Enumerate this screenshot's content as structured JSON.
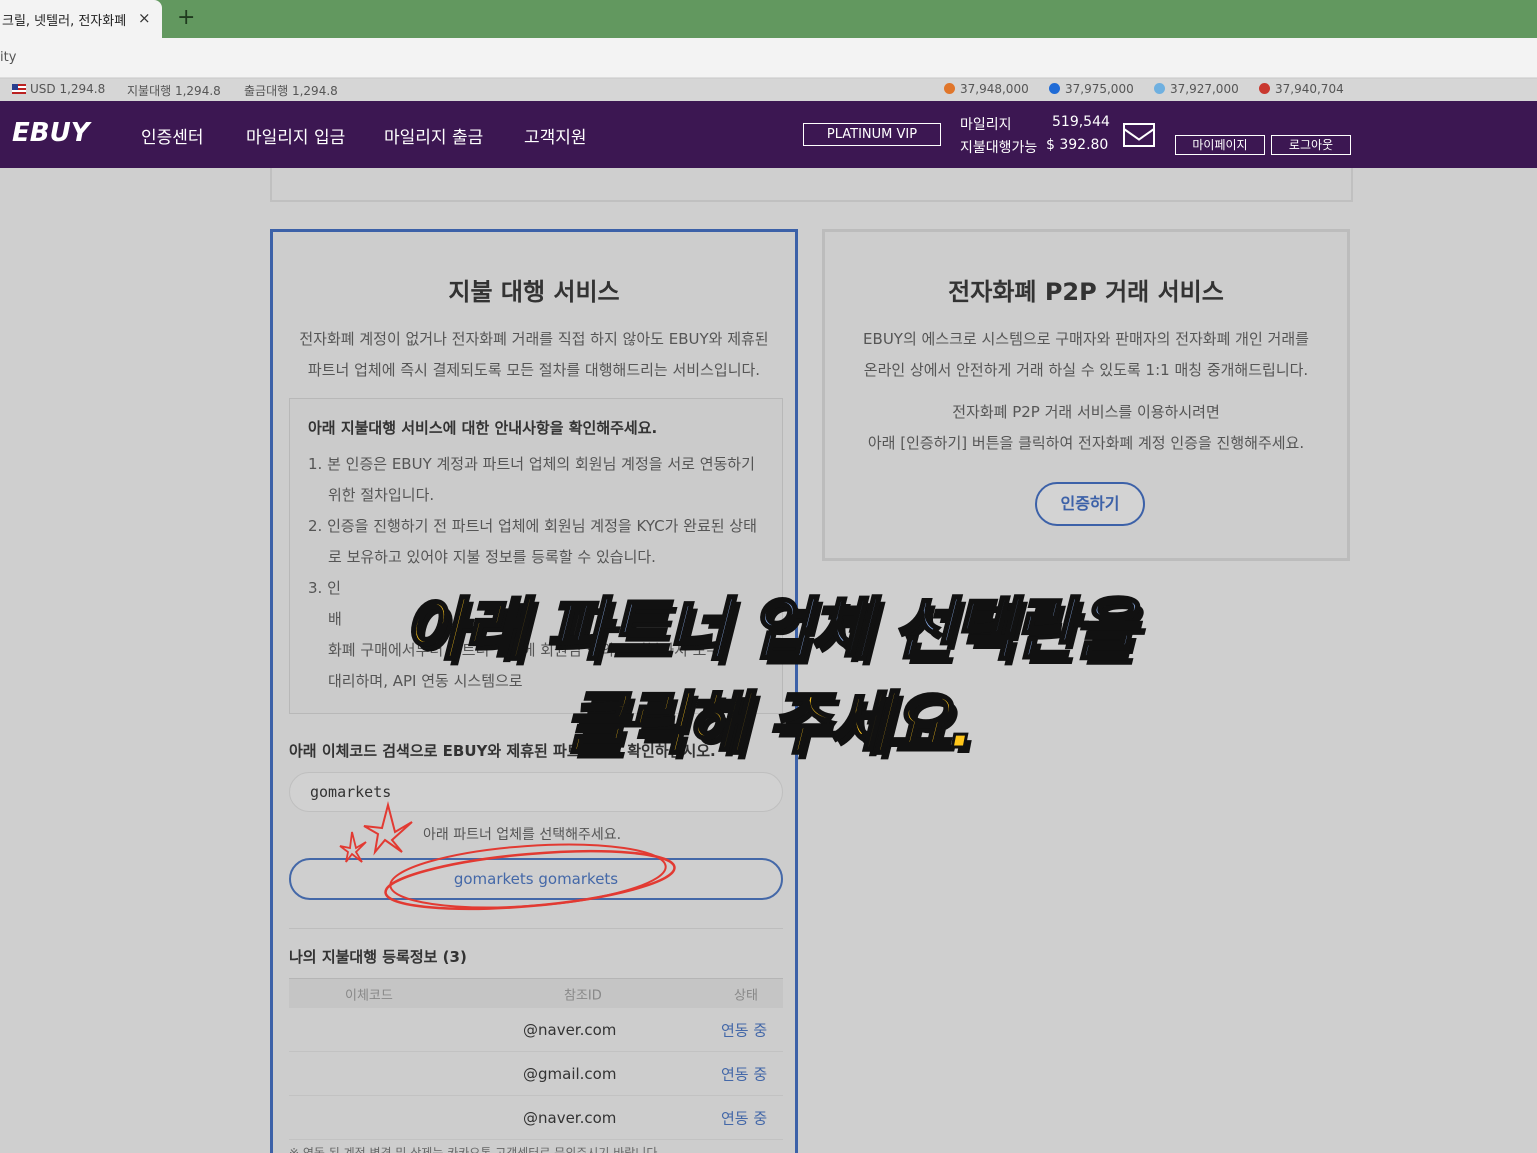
{
  "browser": {
    "tab_title": "크릴, 넷텔러, 전자화폐",
    "tab_close": "×",
    "new_tab": "+",
    "url_fragment": "ity"
  },
  "ticker": {
    "usd": "USD 1,294.8",
    "payment_rate": "지불대행 1,294.8",
    "withdraw_rate": "출금대행 1,294.8",
    "coins": [
      "37,948,000",
      "37,975,000",
      "37,927,000",
      "37,940,704"
    ],
    "coin_colors": [
      "#e0762b",
      "#1f6bd6",
      "#6fb0e0",
      "#c9382f"
    ]
  },
  "nav": {
    "logo": "EBUY",
    "links": [
      "인증센터",
      "마일리지 입금",
      "마일리지 출금",
      "고객지원"
    ],
    "vip": "PLATINUM VIP",
    "mileage_label": "마일리지",
    "mileage_value": "519,544",
    "payable_label": "지불대행가능",
    "payable_value": "$ 392.80",
    "mypage": "마이페이지",
    "logout": "로그아웃"
  },
  "payment_service": {
    "title": "지불 대행 서비스",
    "desc_1": "전자화폐 계정이 없거나 전자화폐 거래를 직접 하지 않아도 EBUY와 제휴된",
    "desc_2": "파트너 업체에 즉시 결제되도록 모든 절차를 대행해드리는 서비스입니다.",
    "notice_title": "아래 지불대행 서비스에 대한 안내사항을 확인해주세요.",
    "notice_items": [
      "1. 본 인증은 EBUY 계정과 파트너 업체의 회원님 계정을 서로 연동하기 위한 절차입니다.",
      "2. 인증을 진행하기 전 파트너 업체에 회원님 계정을 KYC가 완료된 상태로 보유하고 있어야 지불 정보를 등록할 수 있습니다.",
      "3. 인",
      "배",
      "화폐 구매에서부터 파트너 업체에 회원님 명의로 지불까지 모두",
      "대리하며, API 연동 시스템으로"
    ],
    "search_label": "아래 이체코드 검색으로 EBUY와 제휴된 파트너인지 확인하십시오.",
    "search_value": "gomarkets",
    "select_hint": "아래 파트너 업체를 선택해주세요.",
    "select_option": "gomarkets   gomarkets",
    "registered_title": "나의 지불대행 등록정보 (3)",
    "table_headers": [
      "이체코드",
      "참조ID",
      "상태"
    ],
    "rows": [
      {
        "code": "",
        "ref": "@naver.com",
        "status": "연동 중"
      },
      {
        "code": "",
        "ref": "@gmail.com",
        "status": "연동 중"
      },
      {
        "code": "",
        "ref": "@naver.com",
        "status": "연동 중"
      }
    ],
    "footnote": "※ 연동 된 계정 변경 및 삭제는 카카오톡 고객센터로 문의주시기 바랍니다."
  },
  "p2p_service": {
    "title": "전자화폐 P2P 거래 서비스",
    "desc_1": "EBUY의 에스크로 시스템으로 구매자와 판매자의 전자화폐 개인 거래를",
    "desc_2": "온라인 상에서 안전하게 거래 하실 수 있도록 1:1 매칭 중개해드립니다.",
    "desc_3": "전자화폐 P2P 거래 서비스를 이용하시려면",
    "desc_4": "아래 [인증하기] 버튼을 클릭하여 전자화폐 계정 인증을 진행해주세요.",
    "cert_button": "인증하기"
  },
  "caption": {
    "line1_a": "아래",
    "line1_b": "파트너 업체 선택란을",
    "line2": "클릭해 주세요.",
    "colors": {
      "yellow": "#ffc61a",
      "blue": "#8fb2ee"
    }
  }
}
